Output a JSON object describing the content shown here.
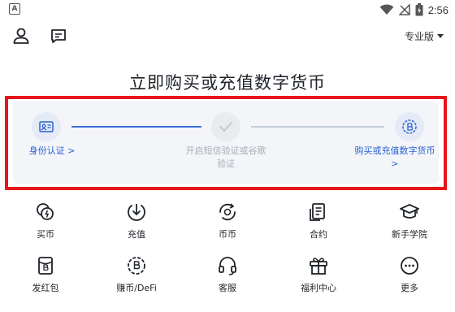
{
  "status_bar": {
    "notification_icon": "a-notification-icon",
    "notification_glyph": "A",
    "time": "2:56",
    "icons": [
      "wifi-icon",
      "signal-off-icon",
      "battery-icon"
    ]
  },
  "top_bar": {
    "profile_icon": "person-icon",
    "messages_icon": "message-icon",
    "version_label": "专业版"
  },
  "headline": "立即购买或充值数字货币",
  "steps": [
    {
      "label": "身份认证 >",
      "icon": "id-card-icon",
      "state": "active"
    },
    {
      "label": "开启短信验证或谷歌验证",
      "icon": "check-icon",
      "state": "disabled"
    },
    {
      "label": "购买或充值数字货币 >",
      "icon": "bitcoin-coin-icon",
      "state": "active"
    }
  ],
  "shortcuts": [
    {
      "label": "买币",
      "icon": "buy-coin-icon"
    },
    {
      "label": "充值",
      "icon": "deposit-icon"
    },
    {
      "label": "币币",
      "icon": "exchange-icon"
    },
    {
      "label": "合约",
      "icon": "contract-icon"
    },
    {
      "label": "新手学院",
      "icon": "graduation-cap-icon"
    },
    {
      "label": "发红包",
      "icon": "red-packet-icon"
    },
    {
      "label": "赚币/DeFi",
      "icon": "earn-coin-icon"
    },
    {
      "label": "客服",
      "icon": "headset-icon"
    },
    {
      "label": "福利中心",
      "icon": "gift-icon"
    },
    {
      "label": "更多",
      "icon": "more-icon"
    }
  ],
  "colors": {
    "accent": "#2a61d4",
    "highlight_border": "#e8151b",
    "card_bg": "#f3f5f9",
    "disabled_text": "#a7adb6"
  }
}
